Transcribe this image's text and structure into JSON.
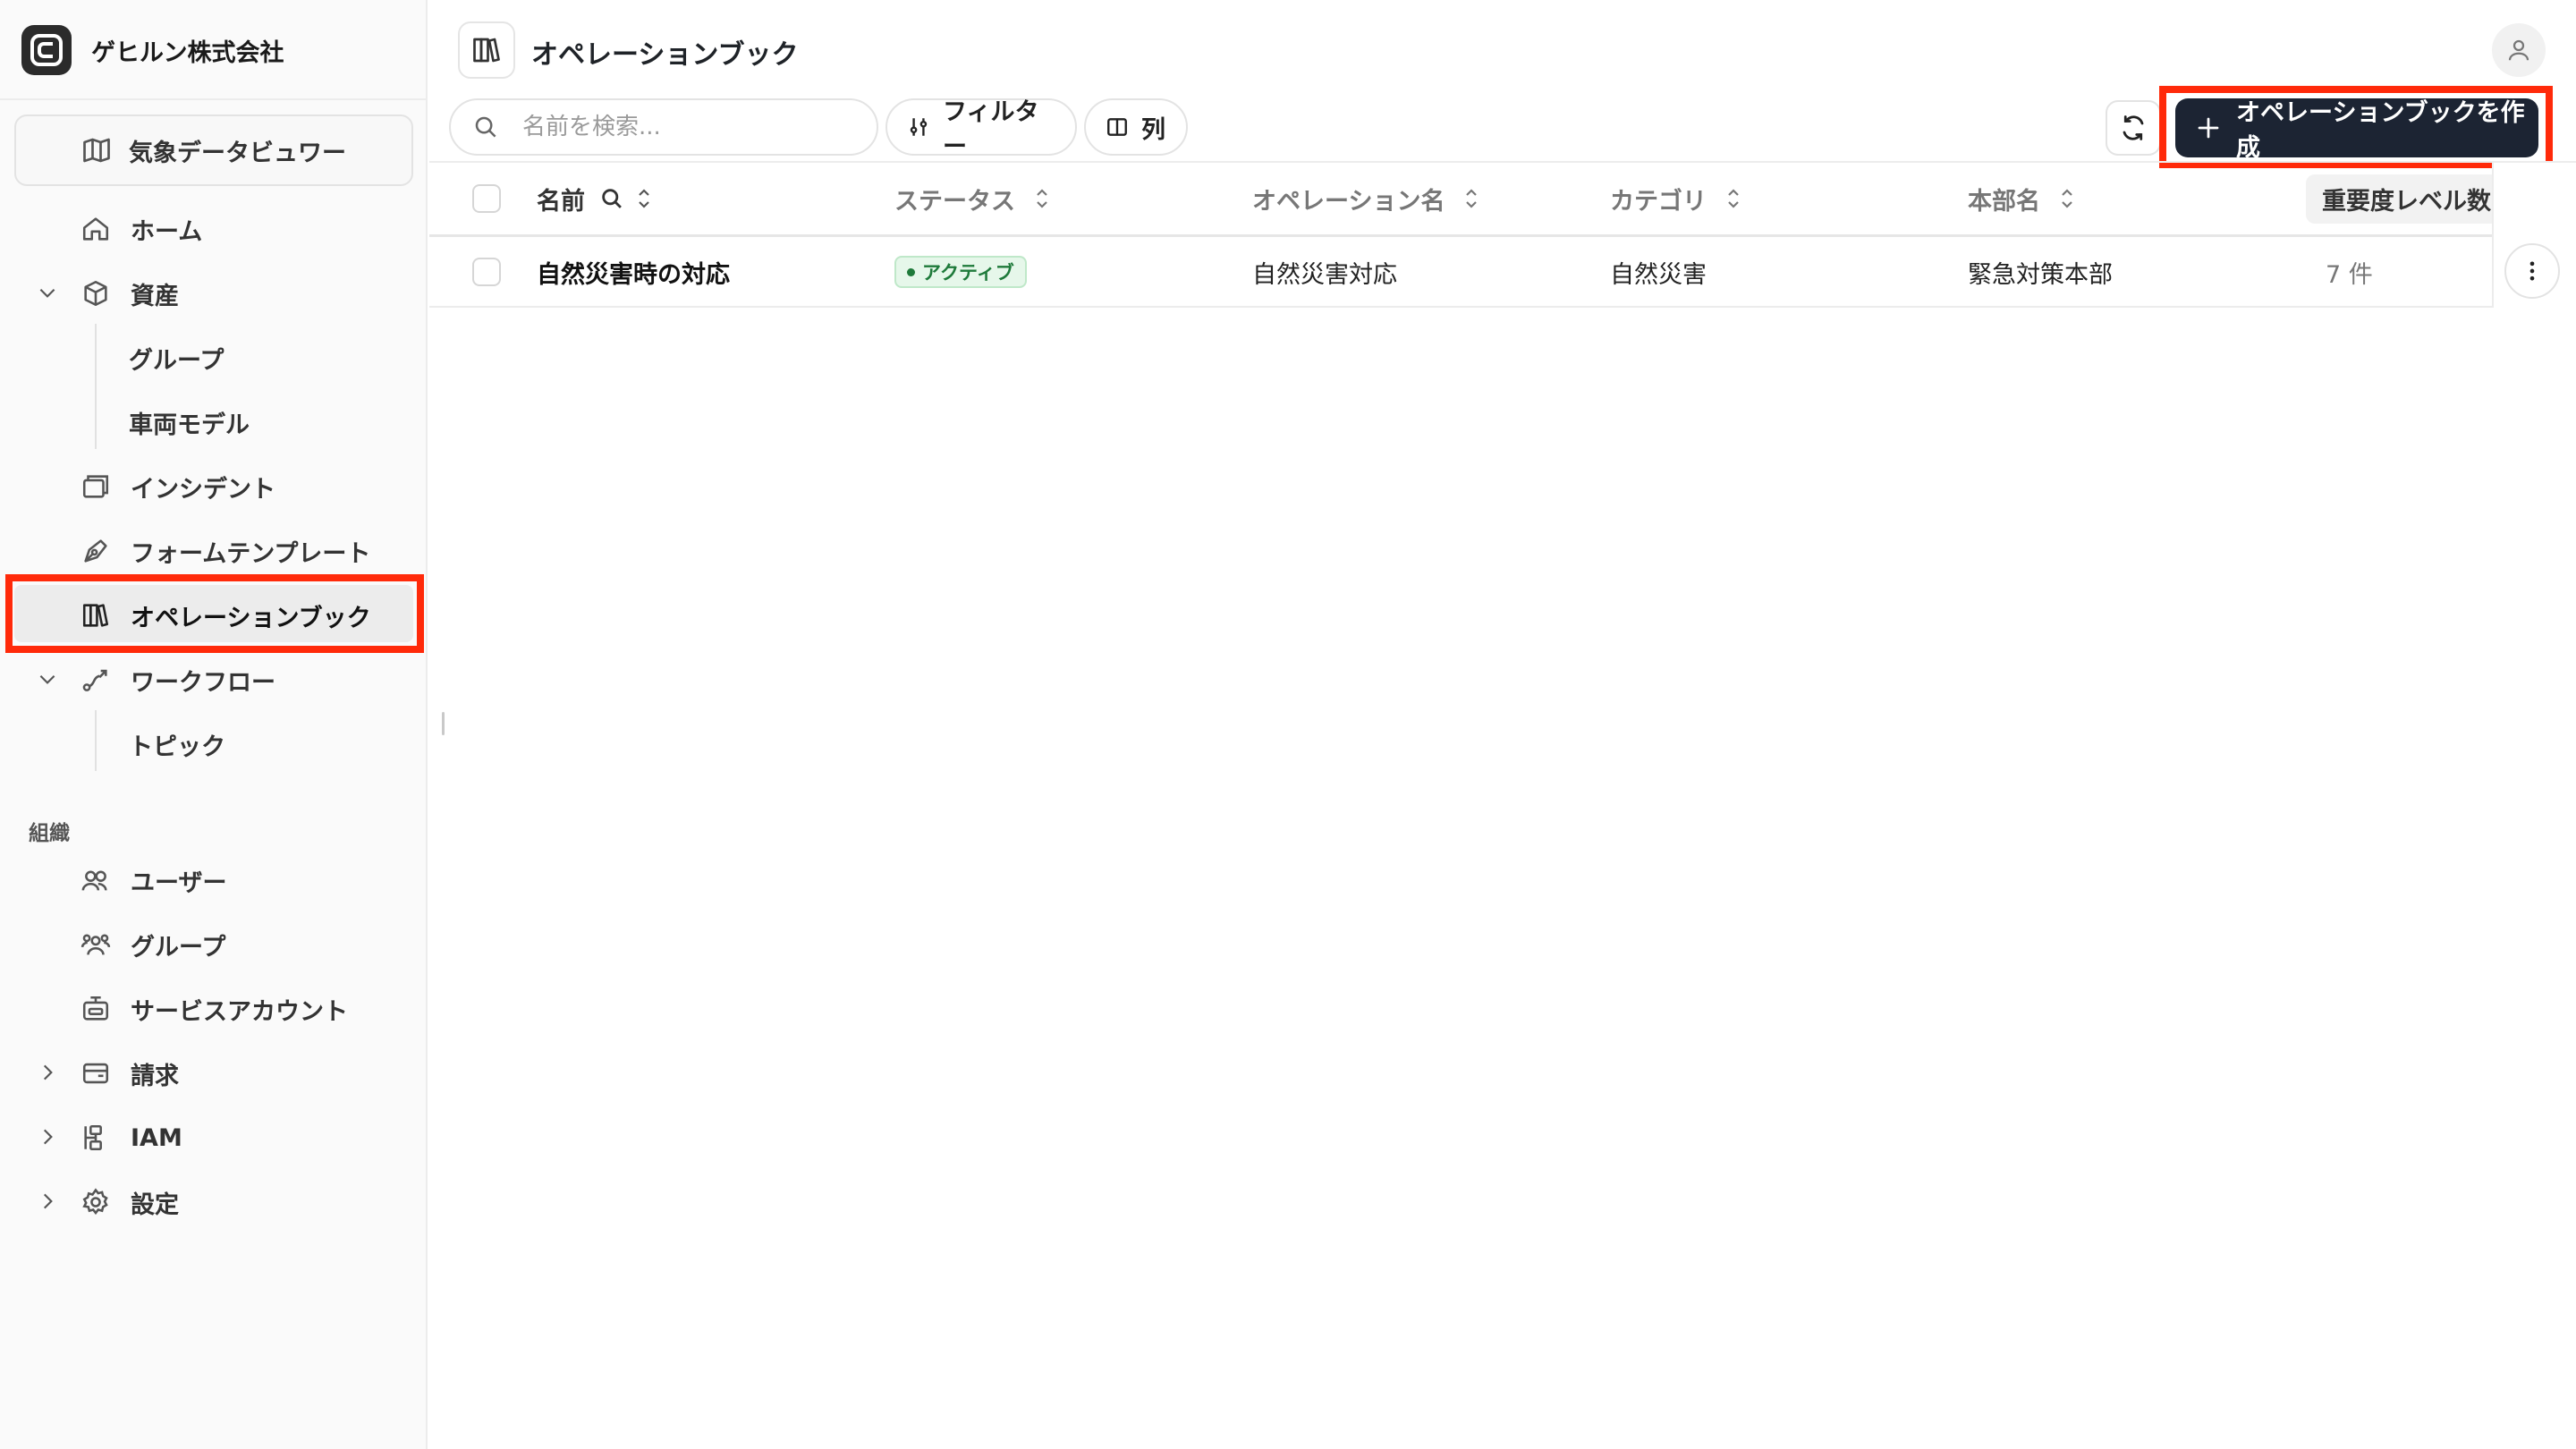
{
  "brand": {
    "name": "ゲヒルン株式会社",
    "logo_icon": "gehirn-logo-icon"
  },
  "sidebar": {
    "weather_viewer": "気象データビュワー",
    "items": [
      {
        "label": "ホーム",
        "icon": "home-icon"
      },
      {
        "label": "資産",
        "icon": "box-icon",
        "expanded": true
      },
      {
        "label": "グループ"
      },
      {
        "label": "車両モデル"
      },
      {
        "label": "インシデント",
        "icon": "window-stack-icon"
      },
      {
        "label": "フォームテンプレート",
        "icon": "pen-tool-icon"
      },
      {
        "label": "オペレーションブック",
        "icon": "books-icon",
        "active": true
      },
      {
        "label": "ワークフロー",
        "icon": "route-icon",
        "expanded": true
      },
      {
        "label": "トピック"
      }
    ],
    "section_org": "組織",
    "org_items": [
      {
        "label": "ユーザー",
        "icon": "users-icon"
      },
      {
        "label": "グループ",
        "icon": "group-icon"
      },
      {
        "label": "サービスアカウント",
        "icon": "bot-icon"
      },
      {
        "label": "請求",
        "icon": "wallet-icon"
      },
      {
        "label": "IAM",
        "icon": "iam-icon"
      },
      {
        "label": "設定",
        "icon": "gear-icon"
      }
    ]
  },
  "header": {
    "title": "オペレーションブック"
  },
  "toolbar": {
    "search_placeholder": "名前を検索...",
    "filter_label": "フィルター",
    "columns_label": "列",
    "create_label": "オペレーションブックを作成"
  },
  "table": {
    "columns": [
      "名前",
      "ステータス",
      "オペレーション名",
      "カテゴリ",
      "本部名",
      "重要度レベル数"
    ],
    "rows": [
      {
        "name": "自然災害時の対応",
        "status": "アクティブ",
        "operation_name": "自然災害対応",
        "category": "自然災害",
        "hq_name": "緊急対策本部",
        "severity_count": "7 件"
      }
    ]
  },
  "colors": {
    "highlight": "#ff2a0a",
    "primary_button": "#1c2433",
    "status_active": "#1e7a3a"
  }
}
